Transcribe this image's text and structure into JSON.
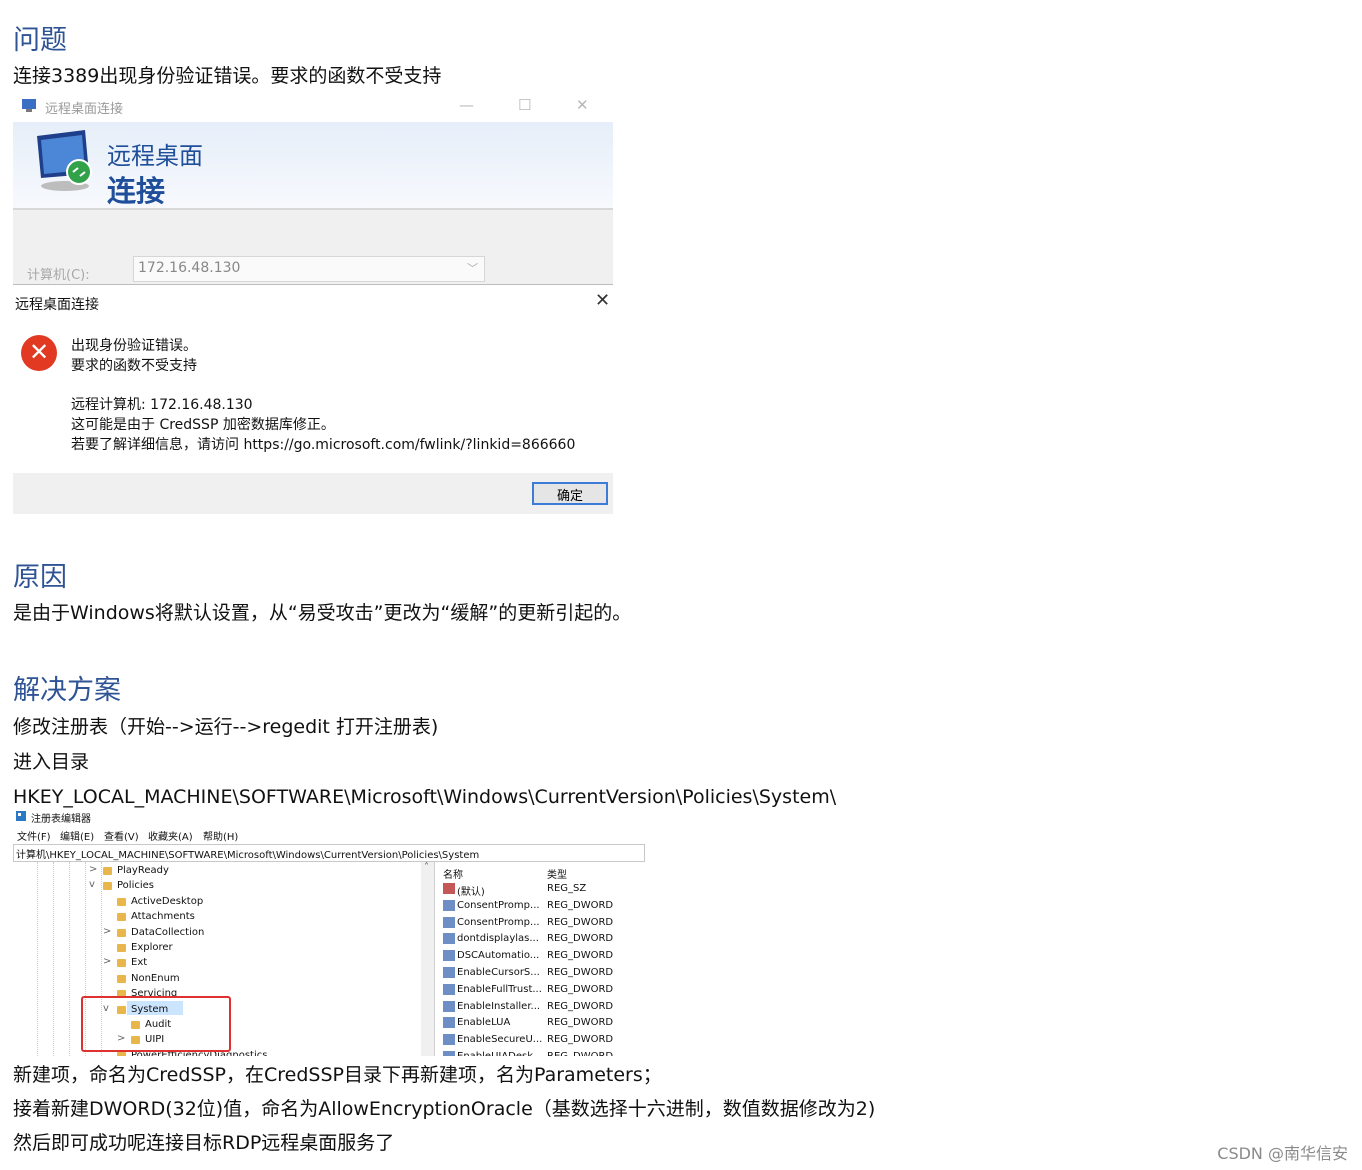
{
  "sections": {
    "problem_title": "问题",
    "problem_text": "连接3389出现身份验证错误。要求的函数不受支持",
    "cause_title": "原因",
    "cause_text": "是由于Windows将默认设置，从“易受攻击”更改为“缓解”的更新引起的。",
    "solution_title": "解决方案",
    "solution_lines": [
      "修改注册表（开始-->运行-->regedit 打开注册表)",
      "进入目录",
      "HKEY_LOCAL_MACHINE\\SOFTWARE\\Microsoft\\Windows\\CurrentVersion\\Policies\\System\\"
    ],
    "after_lines": [
      "新建项，命名为CredSSP，在CredSSP目录下再新建项，名为Parameters；",
      "接着新建DWORD(32位)值，命名为AllowEncryptionOracle（基数选择十六进制，数值数据修改为2)",
      "然后即可成功呢连接目标RDP远程桌面服务了"
    ]
  },
  "rdp": {
    "window_title": "远程桌面连接",
    "minimize": "—",
    "maximize": "☐",
    "close": "✕",
    "banner_line1": "远程桌面",
    "banner_line2": "连接",
    "computer_label": "计算机(C):",
    "computer_value": "172.16.48.130",
    "dropdown": "﹀"
  },
  "dialog": {
    "title": "远程桌面连接",
    "close": "✕",
    "error_glyph": "✕",
    "line1": "出现身份验证错误。",
    "line2": "要求的函数不受支持",
    "line3": "远程计算机: 172.16.48.130",
    "line4": "这可能是由于 CredSSP 加密数据库修正。",
    "line5": "若要了解详细信息，请访问 https://go.microsoft.com/fwlink/?linkid=866660",
    "ok": "确定"
  },
  "regedit": {
    "title": "注册表编辑器",
    "menu": [
      "文件(F)",
      "编辑(E)",
      "查看(V)",
      "收藏夹(A)",
      "帮助(H)"
    ],
    "address": "计算机\\HKEY_LOCAL_MACHINE\\SOFTWARE\\Microsoft\\Windows\\CurrentVersion\\Policies\\System",
    "tree": [
      {
        "label": "PlayReady",
        "expander": ">"
      },
      {
        "label": "Policies",
        "expander": "v"
      },
      {
        "label": "ActiveDesktop",
        "expander": ""
      },
      {
        "label": "Attachments",
        "expander": ""
      },
      {
        "label": "DataCollection",
        "expander": ">"
      },
      {
        "label": "Explorer",
        "expander": ""
      },
      {
        "label": "Ext",
        "expander": ">"
      },
      {
        "label": "NonEnum",
        "expander": ""
      },
      {
        "label": "Servicing",
        "expander": ""
      },
      {
        "label": "System",
        "expander": "v"
      },
      {
        "label": "Audit",
        "expander": ""
      },
      {
        "label": "UIPI",
        "expander": ">"
      },
      {
        "label": "PowerEfficiencyDiagnostics",
        "expander": ""
      }
    ],
    "col_name": "名称",
    "col_type": "类型",
    "values": [
      {
        "name": "(默认)",
        "type": "REG_SZ"
      },
      {
        "name": "ConsentPromp...",
        "type": "REG_DWORD"
      },
      {
        "name": "ConsentPromp...",
        "type": "REG_DWORD"
      },
      {
        "name": "dontdisplaylas...",
        "type": "REG_DWORD"
      },
      {
        "name": "DSCAutomatio...",
        "type": "REG_DWORD"
      },
      {
        "name": "EnableCursorS...",
        "type": "REG_DWORD"
      },
      {
        "name": "EnableFullTrust...",
        "type": "REG_DWORD"
      },
      {
        "name": "EnableInstaller...",
        "type": "REG_DWORD"
      },
      {
        "name": "EnableLUA",
        "type": "REG_DWORD"
      },
      {
        "name": "EnableSecureU...",
        "type": "REG_DWORD"
      },
      {
        "name": "EnableUIADesk...",
        "type": "REG_DWORD"
      }
    ],
    "scroll_up": "˄"
  },
  "watermark": "CSDN @南华信安"
}
